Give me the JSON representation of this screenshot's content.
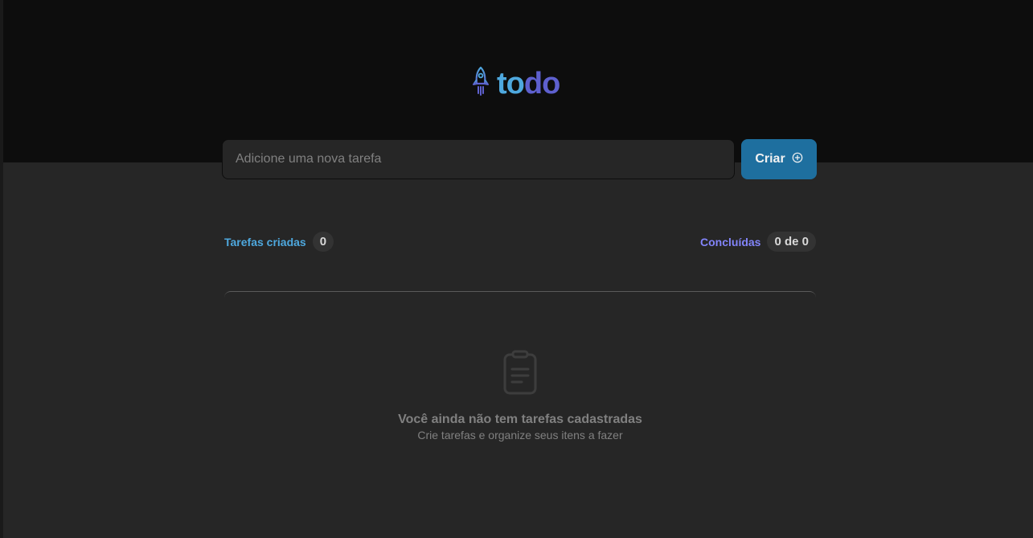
{
  "app": {
    "logo": {
      "text_part1": "to",
      "text_part2": "do",
      "icon": "rocket-icon"
    },
    "colors": {
      "header_bg": "#0d0d0d",
      "body_bg": "#262626",
      "blue": "#4ea8de",
      "purple": "#5e60ce",
      "purple_light": "#8284fa",
      "button_bg": "#1e6f9f"
    }
  },
  "new_task": {
    "placeholder": "Adicione uma nova tarefa",
    "value": "",
    "create_label": "Criar",
    "create_icon": "plus-circle-icon"
  },
  "counters": {
    "created_label": "Tarefas criadas",
    "created_count": "0",
    "done_label": "Concluídas",
    "done_count": "0 de 0"
  },
  "empty_state": {
    "icon": "clipboard-icon",
    "title": "Você ainda não tem tarefas cadastradas",
    "subtitle": "Crie tarefas e organize seus itens a fazer"
  }
}
